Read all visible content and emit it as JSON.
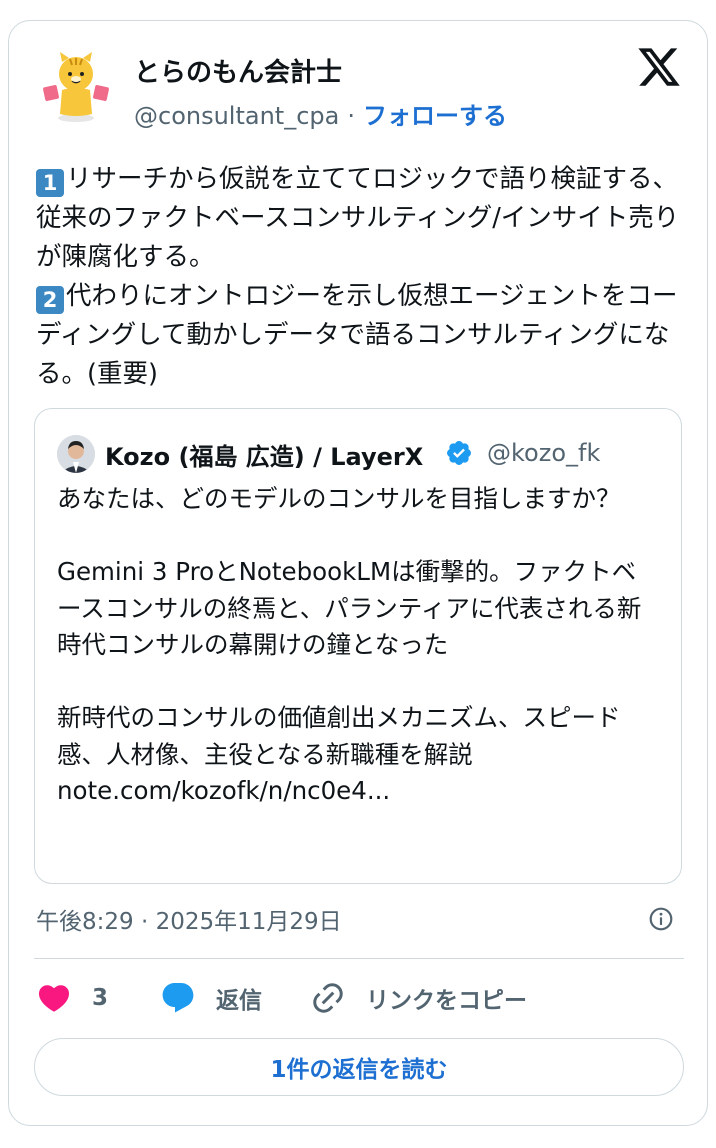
{
  "author": {
    "name": "とらのもん会計士",
    "handle": "@consultant_cpa",
    "separator": "·",
    "follow_label": "フォローする"
  },
  "tweet": {
    "line1_badge": "1",
    "line1_text": "リサーチから仮説を立ててロジックで語り検証する、従来のファクトベースコンサルティング/インサイト売りが陳腐化する。",
    "line2_badge": "2",
    "line2_text": "代わりにオントロジーを示し仮想エージェントをコーディングして動かしデータで語るコンサルティングになる。(重要)"
  },
  "quote": {
    "name": "Kozo (福島 広造) / LayerX",
    "handle": "@kozo_fk",
    "text": "あなたは、どのモデルのコンサルを目指しますか？\n\nGemini 3 ProとNotebookLMは衝撃的。ファクトベースコンサルの終焉と、パランティアに代表される新時代コンサルの幕開けの鐘となった\n\n新時代のコンサルの価値創出メカニズム、スピード感、人材像、主役となる新職種を解説\nnote.com/kozofk/n/nc0e4..."
  },
  "timestamp": "午後8:29 · 2025年11月29日",
  "actions": {
    "like_count": "3",
    "reply_label": "返信",
    "copy_link_label": "リンクをコピー"
  },
  "read_replies_label": "1件の返信を読む",
  "icons": {
    "brand": "x-logo-icon",
    "verified": "verified-badge-icon",
    "info": "info-icon",
    "like": "heart-icon",
    "reply": "speech-bubble-icon",
    "copy": "link-icon"
  },
  "colors": {
    "link_blue": "#1d6fd1",
    "verified_blue": "#1d9bf0",
    "heart_pink": "#f91880",
    "text_gray": "#536471",
    "border": "#cfd9de",
    "keycap_blue": "#3b88c3"
  }
}
